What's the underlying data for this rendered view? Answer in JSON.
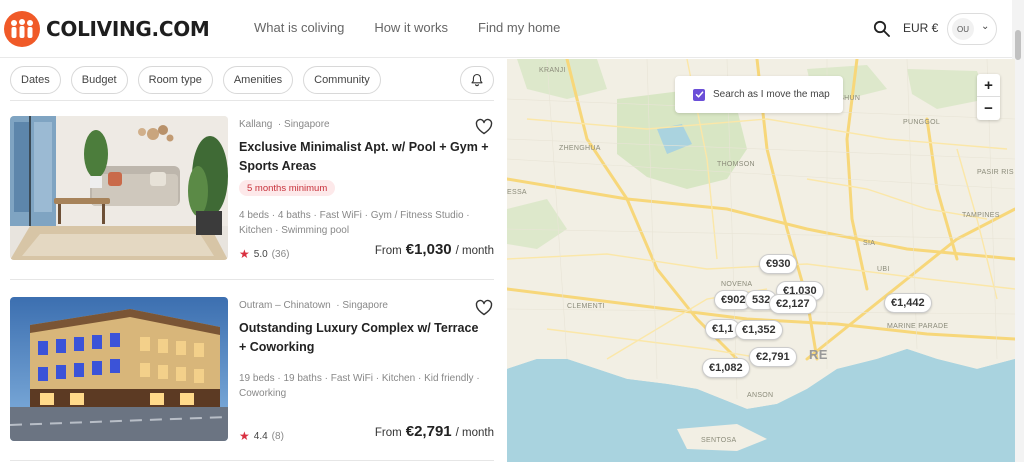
{
  "header": {
    "brand": "COLIVING.COM",
    "nav": [
      "What is coliving",
      "How it works",
      "Find my home"
    ],
    "currency": "EUR €",
    "user_initials": "OU"
  },
  "filters": [
    "Dates",
    "Budget",
    "Room type",
    "Amenities",
    "Community"
  ],
  "listings": [
    {
      "location": "Kallang",
      "city": "Singapore",
      "title": "Exclusive Minimalist Apt. w/ Pool + Gym + Sports Areas",
      "badge": "5 months minimum",
      "features": "4 beds · 4 baths · Fast WiFi · Gym / Fitness Studio · Kitchen · Swimming pool",
      "rating": "5.0",
      "reviews": "(36)",
      "price_prefix": "From",
      "price": "€1,030",
      "price_suffix": "/ month"
    },
    {
      "location": "Outram – Chinatown",
      "city": "Singapore",
      "title": "Outstanding Luxury Complex w/ Terrace + Coworking",
      "features": "19 beds · 19 baths · Fast WiFi · Kitchen · Kid friendly · Coworking",
      "rating": "4.4",
      "reviews": "(8)",
      "price_prefix": "From",
      "price": "€2,791",
      "price_suffix": "/ month"
    }
  ],
  "map": {
    "search_as_move": "Search as I move the map",
    "zoom_in": "+",
    "zoom_out": "−",
    "labels": [
      "KRANJI",
      "YISHUN",
      "PUNGGOL",
      "ZHENGHUA",
      "THOMSON",
      "PASIR RIS",
      "TAMPINES",
      "NOVENA",
      "UBI",
      "CLEMENTI",
      "MARINE PARADE",
      "ANSON",
      "SENTOSA",
      "ESSA",
      "SIA",
      "RE"
    ],
    "pins": [
      "€930",
      "€1,030",
      "€902",
      "532",
      "€2,127",
      "€1,442",
      "€1,1",
      "€1,352",
      "€2,791",
      "€1,082"
    ]
  },
  "colors": {
    "brand": "#f05a28",
    "accent": "#6b4fd8",
    "badge_text": "#c7303a",
    "star": "#d93040"
  }
}
